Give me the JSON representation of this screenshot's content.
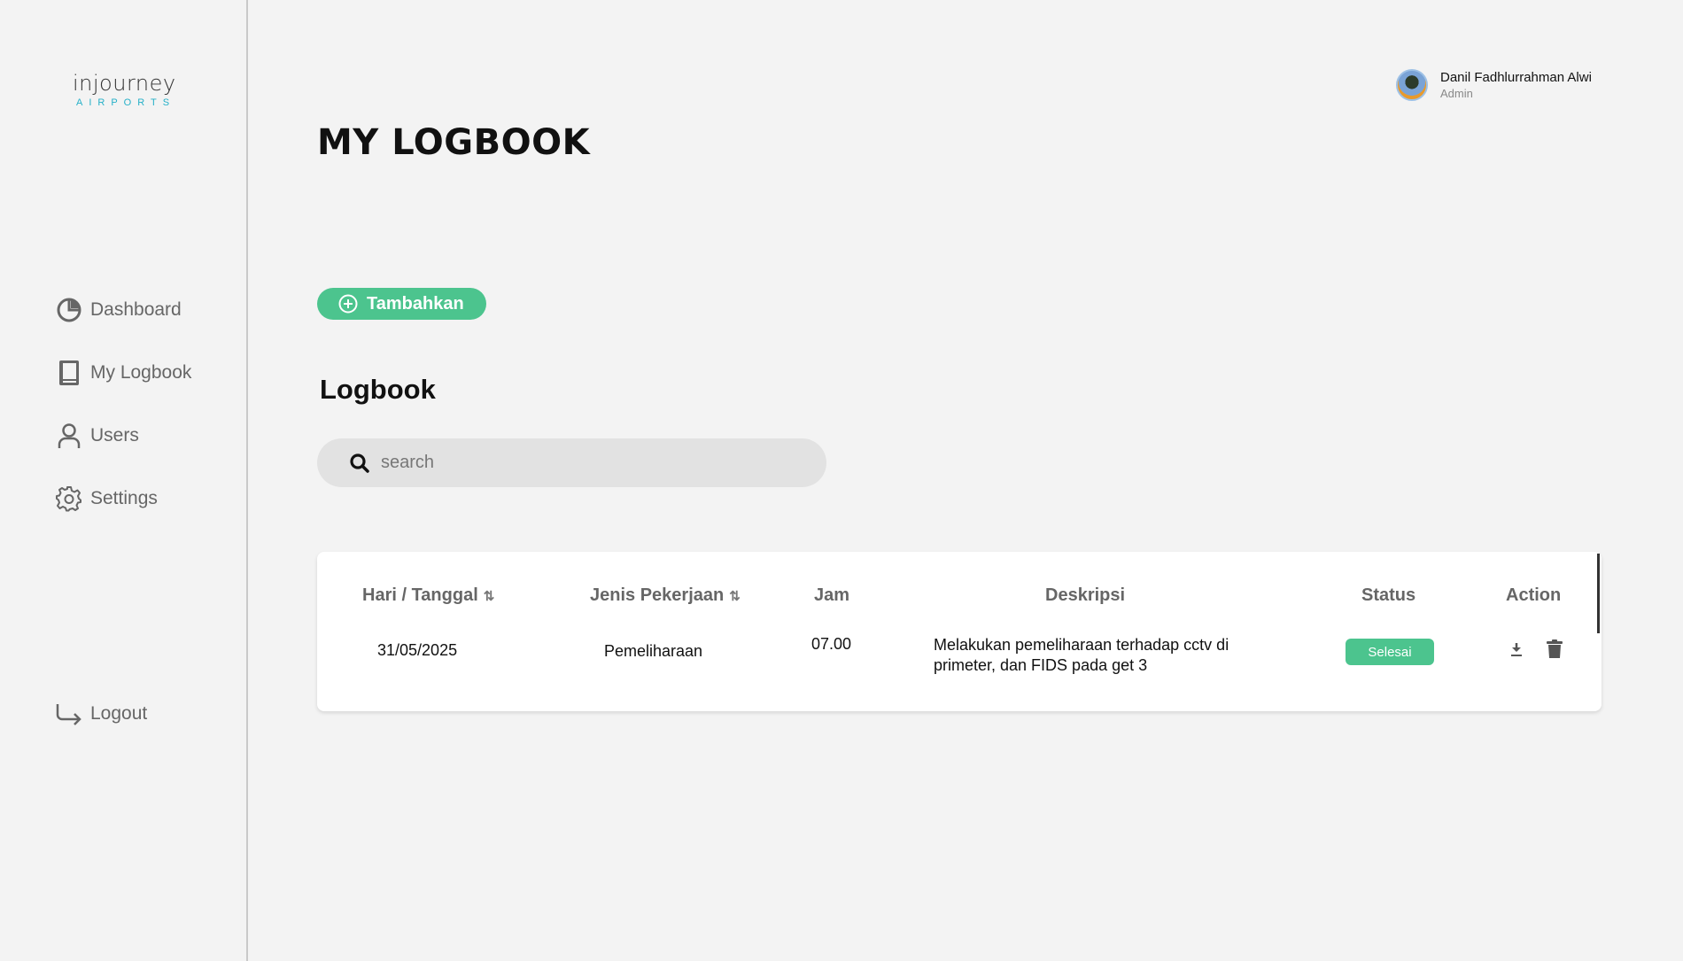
{
  "brand": {
    "logo_main": "injourney",
    "logo_sub": "AIRPORTS"
  },
  "sidebar": {
    "items": [
      {
        "label": "Dashboard",
        "icon": "pie-chart-icon"
      },
      {
        "label": "My Logbook",
        "icon": "book-icon"
      },
      {
        "label": "Users",
        "icon": "user-icon"
      },
      {
        "label": "Settings",
        "icon": "gear-icon"
      }
    ],
    "logout": {
      "label": "Logout",
      "icon": "logout-arrow-icon"
    }
  },
  "user": {
    "name": "Danil Fadhlurrahman Alwi",
    "role": "Admin"
  },
  "page": {
    "title": "MY LOGBOOK",
    "add_button": "Tambahkan",
    "section_title": "Logbook"
  },
  "search": {
    "placeholder": "search",
    "value": ""
  },
  "table": {
    "headers": {
      "date": "Hari / Tanggal",
      "job": "Jenis Pekerjaan",
      "time": "Jam",
      "desc": "Deskripsi",
      "status": "Status",
      "action": "Action"
    },
    "rows": [
      {
        "date": "31/05/2025",
        "job": "Pemeliharaan",
        "time": "07.00",
        "desc_line1": "Melakukan pemeliharaan terhadap cctv di",
        "desc_line2": "primeter, dan FIDS pada get 3",
        "status": "Selesai"
      }
    ]
  },
  "colors": {
    "accent": "#4cc48e",
    "background": "#f3f3f3",
    "search_bg": "#e2e2e2"
  }
}
